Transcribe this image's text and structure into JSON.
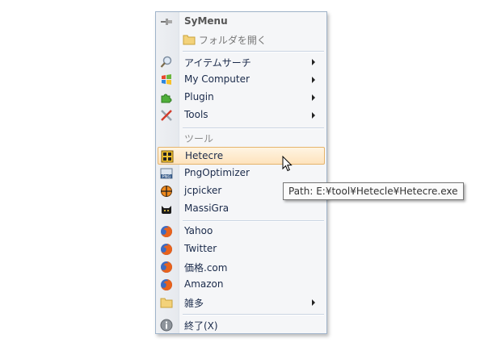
{
  "menu": {
    "title": "SyMenu",
    "open_folder": "フォルダを開く",
    "items_top": [
      {
        "label": "アイテムサーチ",
        "icon": "search-icon"
      },
      {
        "label": "My Computer",
        "icon": "windows-flag-icon"
      },
      {
        "label": "Plugin",
        "icon": "puzzle-icon"
      },
      {
        "label": "Tools",
        "icon": "tools-icon"
      }
    ],
    "category": "ツール",
    "tools": [
      {
        "label": "Hetecre",
        "icon": "hetecre-icon"
      },
      {
        "label": "PngOptimizer",
        "icon": "png-icon"
      },
      {
        "label": "jcpicker",
        "icon": "crosshair-icon"
      },
      {
        "label": "MassiGra",
        "icon": "cat-icon"
      }
    ],
    "links": [
      {
        "label": "Yahoo",
        "icon": "firefox-icon"
      },
      {
        "label": "Twitter",
        "icon": "firefox-icon"
      },
      {
        "label": "価格.com",
        "icon": "firefox-icon"
      },
      {
        "label": "Amazon",
        "icon": "firefox-icon"
      },
      {
        "label": "雑多",
        "icon": "folder-icon"
      }
    ],
    "exit": "終了(X)"
  },
  "tooltip": "Path: E:¥tool¥Hetecle¥Hetecre.exe"
}
